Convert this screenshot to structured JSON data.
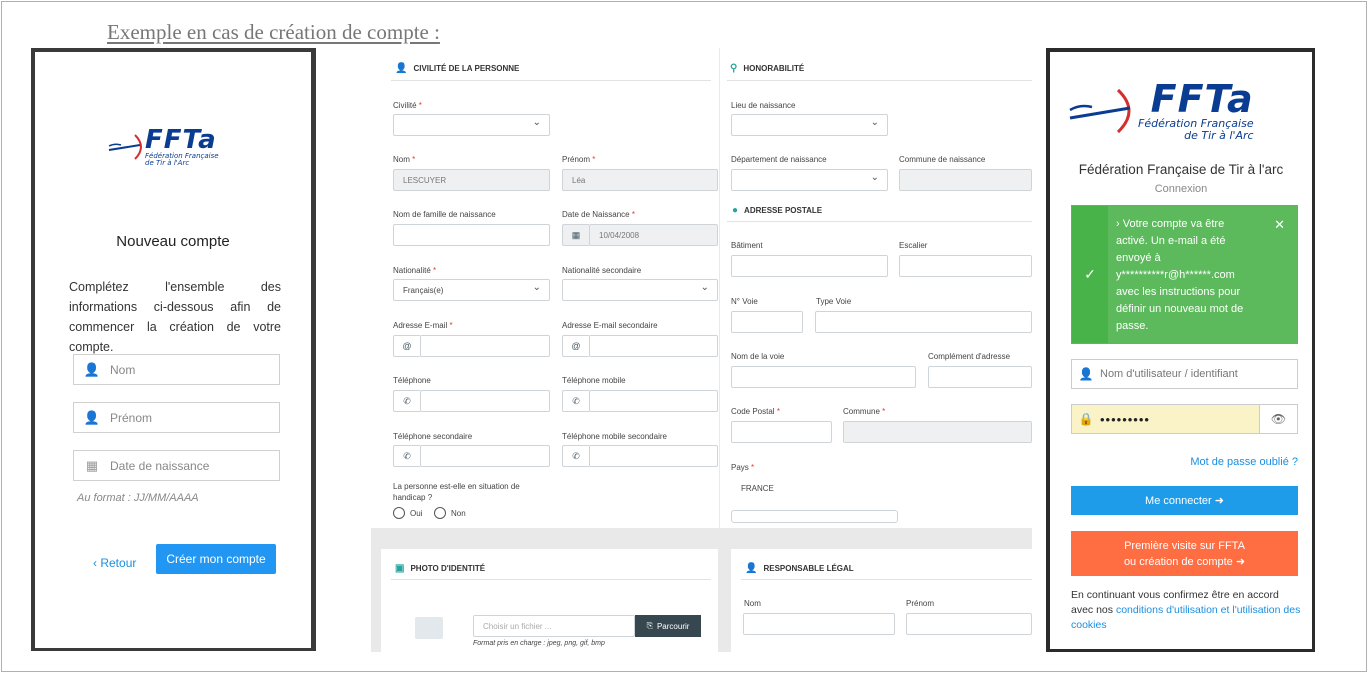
{
  "caption": "Exemple en cas de création de compte :",
  "panel1": {
    "logo_text": "FFTa",
    "logo_sub1": "Fédération Française",
    "logo_sub2": "de Tir à l'Arc",
    "title": "Nouveau compte",
    "intro": "Complétez l'ensemble des informations ci-dessous afin de commencer la création de votre compte.",
    "fields": [
      {
        "icon": "user-icon",
        "placeholder": "Nom"
      },
      {
        "icon": "user-icon",
        "placeholder": "Prénom"
      },
      {
        "icon": "calendar-icon",
        "placeholder": "Date de naissance"
      }
    ],
    "hint": "Au format : JJ/MM/AAAA",
    "back_label": "Retour",
    "create_label": "Créer mon compte",
    "accent": "#2196f3"
  },
  "panel2": {
    "civilite_section": {
      "title": "CIVILITÉ DE LA PERSONNE",
      "civilite_label": "Civilité",
      "nom_label": "Nom",
      "nom_value": "LESCUYER",
      "prenom_label": "Prénom",
      "prenom_value": "Léa",
      "nom_famille_label": "Nom de famille de naissance",
      "date_naissance_label": "Date de Naissance",
      "date_naissance_value": "10/04/2008",
      "nationalite_label": "Nationalité",
      "nationalite_value": "Français(e)",
      "nationalite2_label": "Nationalité secondaire",
      "email_label": "Adresse E-mail",
      "email2_label": "Adresse E-mail secondaire",
      "tel_label": "Téléphone",
      "telmob_label": "Téléphone mobile",
      "tel2_label": "Téléphone secondaire",
      "telmob2_label": "Téléphone mobile secondaire",
      "handicap_label1": "La personne est-elle en situation de",
      "handicap_label2": "handicap ?",
      "oui": "Oui",
      "non": "Non"
    },
    "honorabilite_section": {
      "title": "HONORABILITÉ",
      "lieu_label": "Lieu de naissance",
      "dept_label": "Département de naissance",
      "commune_label": "Commune de naissance"
    },
    "adresse_section": {
      "title": "ADRESSE POSTALE",
      "batiment_label": "Bâtiment",
      "escalier_label": "Escalier",
      "nvoie_label": "N° Voie",
      "typevoie_label": "Type Voie",
      "nomvoie_label": "Nom de la voie",
      "complement_label": "Complément d'adresse",
      "cp_label": "Code Postal",
      "commune_label": "Commune",
      "pays_label": "Pays",
      "pays_value": "FRANCE"
    },
    "photo_section": {
      "title": "PHOTO D'IDENTITÉ",
      "file_placeholder": "Choisir un fichier ...",
      "browse_label": "Parcourir",
      "formats": "Format pris en charge : jpeg, png, gif, bmp"
    },
    "responsable_section": {
      "title": "RESPONSABLE LÉGAL",
      "nom_label": "Nom",
      "prenom_label": "Prénom"
    }
  },
  "panel3": {
    "logo_text": "FFTa",
    "logo_sub1": "Fédération Française",
    "logo_sub2": "de Tir à l'Arc",
    "org_name": "Fédération Française de Tir à l'arc",
    "subtitle": "Connexion",
    "alert_lines": [
      "› Votre compte va être",
      "activé. Un e-mail a été",
      "envoyé à",
      "y**********r@h******.com",
      "avec les instructions pour",
      "définir un nouveau mot de",
      "passe."
    ],
    "username_placeholder": "Nom d'utilisateur / identifiant",
    "password_value": "•••••••••",
    "forgot_label": "Mot de passe oublié ?",
    "login_label": "Me connecter ➜",
    "first_visit_line1": "Première visite sur FFTA",
    "first_visit_line2": "ou création de compte ➜",
    "footer_text": "En continuant vous confirmez être en accord avec nos",
    "footer_link": "conditions d'utilisation et l'utilisation des cookies",
    "colors": {
      "success": "#5cba5c",
      "login": "#1e9be9",
      "signup": "#ff6d42",
      "brand": "#0a3d91"
    }
  }
}
